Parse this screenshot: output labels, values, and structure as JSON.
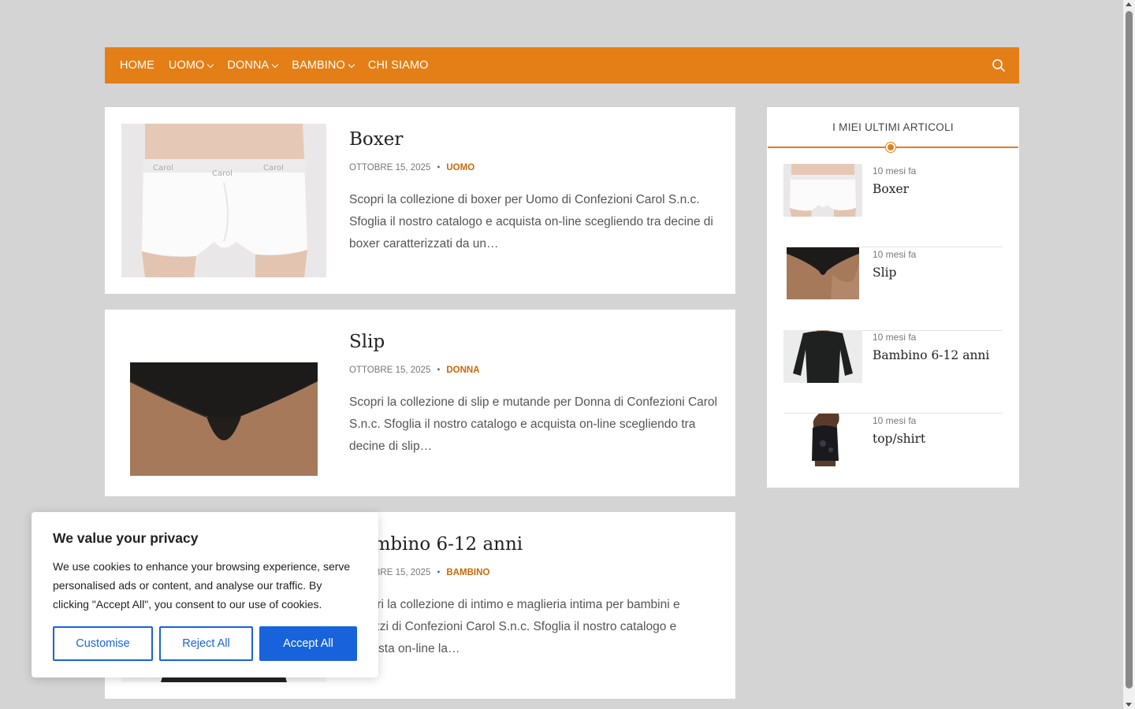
{
  "nav": {
    "items": [
      {
        "label": "HOME",
        "dropdown": false
      },
      {
        "label": "UOMO",
        "dropdown": true
      },
      {
        "label": "DONNA",
        "dropdown": true
      },
      {
        "label": "BAMBINO",
        "dropdown": true
      },
      {
        "label": "CHI SIAMO",
        "dropdown": false
      }
    ],
    "search_icon": "search-icon",
    "color": "#e37f16"
  },
  "posts": [
    {
      "title": "Boxer",
      "date": "OTTOBRE 15, 2025",
      "category": "UOMO",
      "excerpt": "Scopri la collezione di boxer per Uomo di Confezioni Carol S.n.c. Sfoglia il nostro catalogo e acquista on-line scegliendo tra decine di boxer caratterizzati da un…"
    },
    {
      "title": "Slip",
      "date": "OTTOBRE 15, 2025",
      "category": "DONNA",
      "excerpt": "Scopri la collezione di slip e mutande per Donna di Confezioni Carol S.n.c. Sfoglia il nostro catalogo e acquista on-line scegliendo tra decine di slip…"
    },
    {
      "title": "Bambino 6-12 anni",
      "date": "OTTOBRE 15, 2025",
      "category": "BAMBINO",
      "excerpt": "Scopri la collezione di intimo e maglieria intima per bambini e ragazzi di Confezioni Carol S.n.c. Sfoglia il nostro catalogo e acquista on-line la…"
    }
  ],
  "sidebar": {
    "title": "I MIEI ULTIMI ARTICOLI",
    "items": [
      {
        "time": "10 mesi fa",
        "title": "Boxer"
      },
      {
        "time": "10 mesi fa",
        "title": "Slip"
      },
      {
        "time": "10 mesi fa",
        "title": "Bambino 6-12 anni"
      },
      {
        "time": "10 mesi fa",
        "title": "top/shirt"
      }
    ]
  },
  "cookie": {
    "title": "We value your privacy",
    "text": "We use cookies to enhance your browsing experience, serve personalised ads or content, and analyse our traffic. By clicking \"Accept All\", you consent to our use of cookies.",
    "customise": "Customise",
    "reject": "Reject All",
    "accept": "Accept All",
    "color": "#1863dc"
  }
}
